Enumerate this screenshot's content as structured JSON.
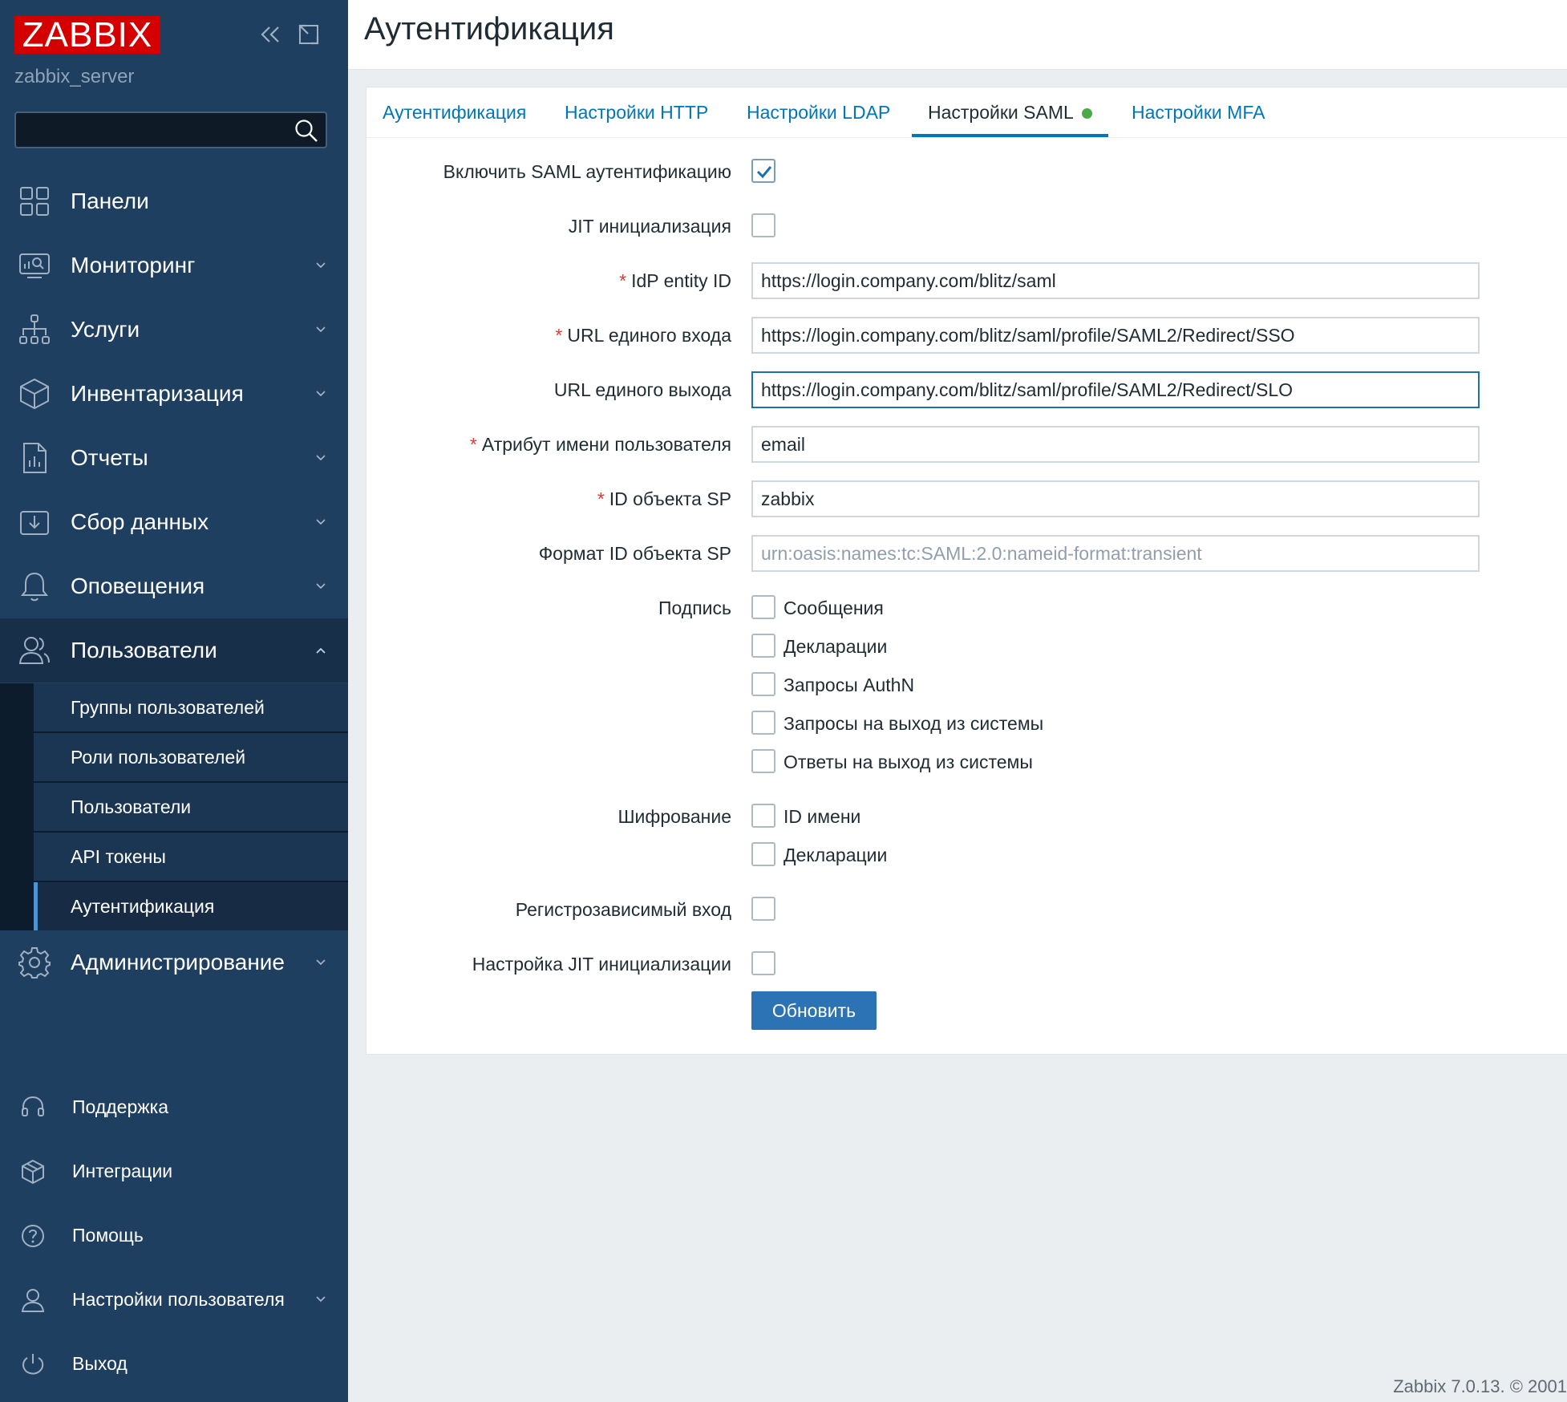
{
  "sidebar": {
    "logo": "ZABBIX",
    "server_name": "zabbix_server",
    "search_placeholder": "",
    "menu": [
      {
        "label": "Панели",
        "icon": "dashboard-icon"
      },
      {
        "label": "Мониторинг",
        "icon": "monitoring-icon"
      },
      {
        "label": "Услуги",
        "icon": "services-icon"
      },
      {
        "label": "Инвентаризация",
        "icon": "inventory-icon"
      },
      {
        "label": "Отчеты",
        "icon": "reports-icon"
      },
      {
        "label": "Сбор данных",
        "icon": "data-collection-icon"
      },
      {
        "label": "Оповещения",
        "icon": "alerts-icon"
      },
      {
        "label": "Пользователи",
        "icon": "users-icon"
      },
      {
        "label": "Администрирование",
        "icon": "gear-icon"
      }
    ],
    "submenu": [
      {
        "label": "Группы пользователей"
      },
      {
        "label": "Роли пользователей"
      },
      {
        "label": "Пользователи"
      },
      {
        "label": "API токены"
      },
      {
        "label": "Аутентификация"
      }
    ],
    "bottom": [
      {
        "label": "Поддержка",
        "icon": "headset-icon"
      },
      {
        "label": "Интеграции",
        "icon": "integrations-icon"
      },
      {
        "label": "Помощь",
        "icon": "help-icon"
      },
      {
        "label": "Настройки пользователя",
        "icon": "user-settings-icon"
      },
      {
        "label": "Выход",
        "icon": "power-icon"
      }
    ]
  },
  "header": {
    "title": "Аутентификация"
  },
  "tabs": [
    {
      "label": "Аутентификация"
    },
    {
      "label": "Настройки HTTP"
    },
    {
      "label": "Настройки LDAP"
    },
    {
      "label": "Настройки SAML"
    },
    {
      "label": "Настройки MFA"
    }
  ],
  "form": {
    "enable_saml": {
      "label": "Включить SAML аутентификацию",
      "checked": true
    },
    "jit": {
      "label": "JIT инициализация",
      "checked": false
    },
    "idp_entity_id": {
      "label": "IdP entity ID",
      "value": "https://login.company.com/blitz/saml"
    },
    "sso_url": {
      "label": "URL единого входа",
      "value": "https://login.company.com/blitz/saml/profile/SAML2/Redirect/SSO"
    },
    "slo_url": {
      "label": "URL единого выхода",
      "value": "https://login.company.com/blitz/saml/profile/SAML2/Redirect/SLO"
    },
    "username_attr": {
      "label": "Атрибут имени пользователя",
      "value": "email"
    },
    "sp_entity_id": {
      "label": "ID объекта SP",
      "value": "zabbix"
    },
    "sp_name_id_format": {
      "label": "Формат ID объекта SP",
      "placeholder": "urn:oasis:names:tc:SAML:2.0:nameid-format:transient"
    },
    "sign": {
      "label": "Подпись",
      "options": [
        "Сообщения",
        "Декларации",
        "Запросы AuthN",
        "Запросы на выход из системы",
        "Ответы на выход из системы"
      ]
    },
    "encrypt": {
      "label": "Шифрование",
      "options": [
        "ID имени",
        "Декларации"
      ]
    },
    "case_sensitive": {
      "label": "Регистрозависимый вход"
    },
    "jit_config": {
      "label": "Настройка JIT инициализации"
    },
    "update_button": "Обновить",
    "required_mark": "*"
  },
  "footer": "Zabbix 7.0.13. © 2001"
}
